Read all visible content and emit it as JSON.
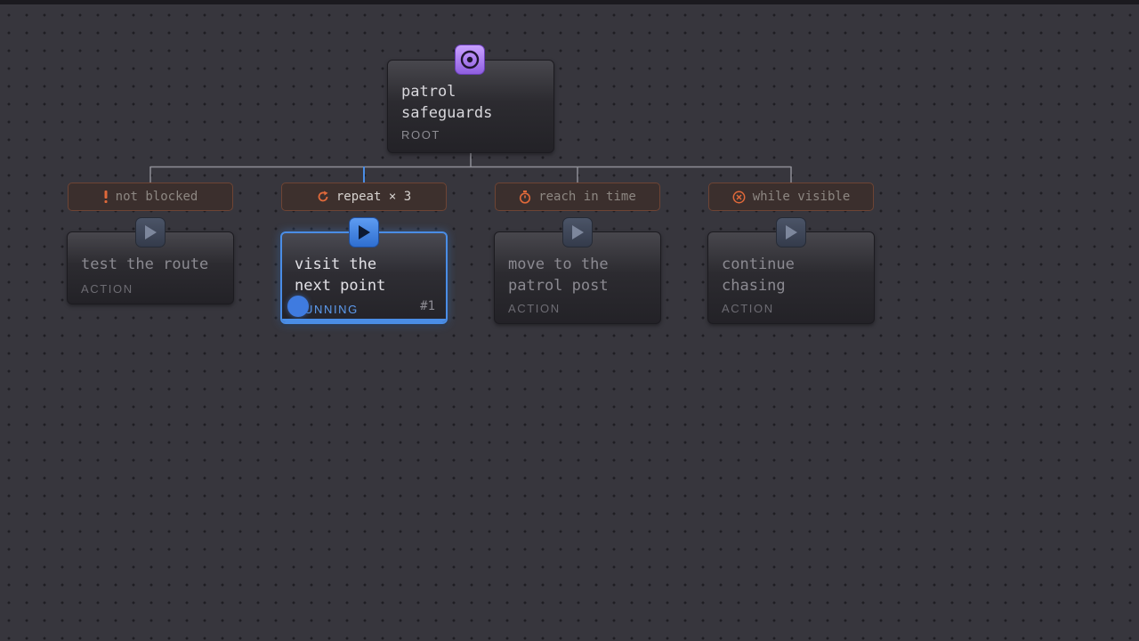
{
  "tree": {
    "root": {
      "title": "patrol\nsafeguards",
      "type": "ROOT",
      "icon": "target-icon",
      "badge_color": "#a97ef5"
    },
    "children": [
      {
        "decorator": {
          "label": "not blocked",
          "icon": "exclamation-icon"
        },
        "action": {
          "title": "test the route",
          "type": "ACTION",
          "state": "idle"
        }
      },
      {
        "decorator": {
          "label": "repeat × 3",
          "icon": "repeat-icon"
        },
        "action": {
          "title": "visit the\nnext point",
          "type": "RUNNING",
          "state": "running",
          "counter": "#1"
        }
      },
      {
        "decorator": {
          "label": "reach in time",
          "icon": "timer-icon"
        },
        "action": {
          "title": "move to the\npatrol post",
          "type": "ACTION",
          "state": "idle"
        }
      },
      {
        "decorator": {
          "label": "while visible",
          "icon": "cancel-circle-icon"
        },
        "action": {
          "title": "continue\nchasing",
          "type": "ACTION",
          "state": "idle"
        }
      }
    ]
  },
  "colors": {
    "canvas": "#37363d",
    "running_accent": "#4a8de6",
    "decorator_border": "#6e4434",
    "decorator_icon": "#e0693a",
    "wire": "#8f8e96"
  }
}
